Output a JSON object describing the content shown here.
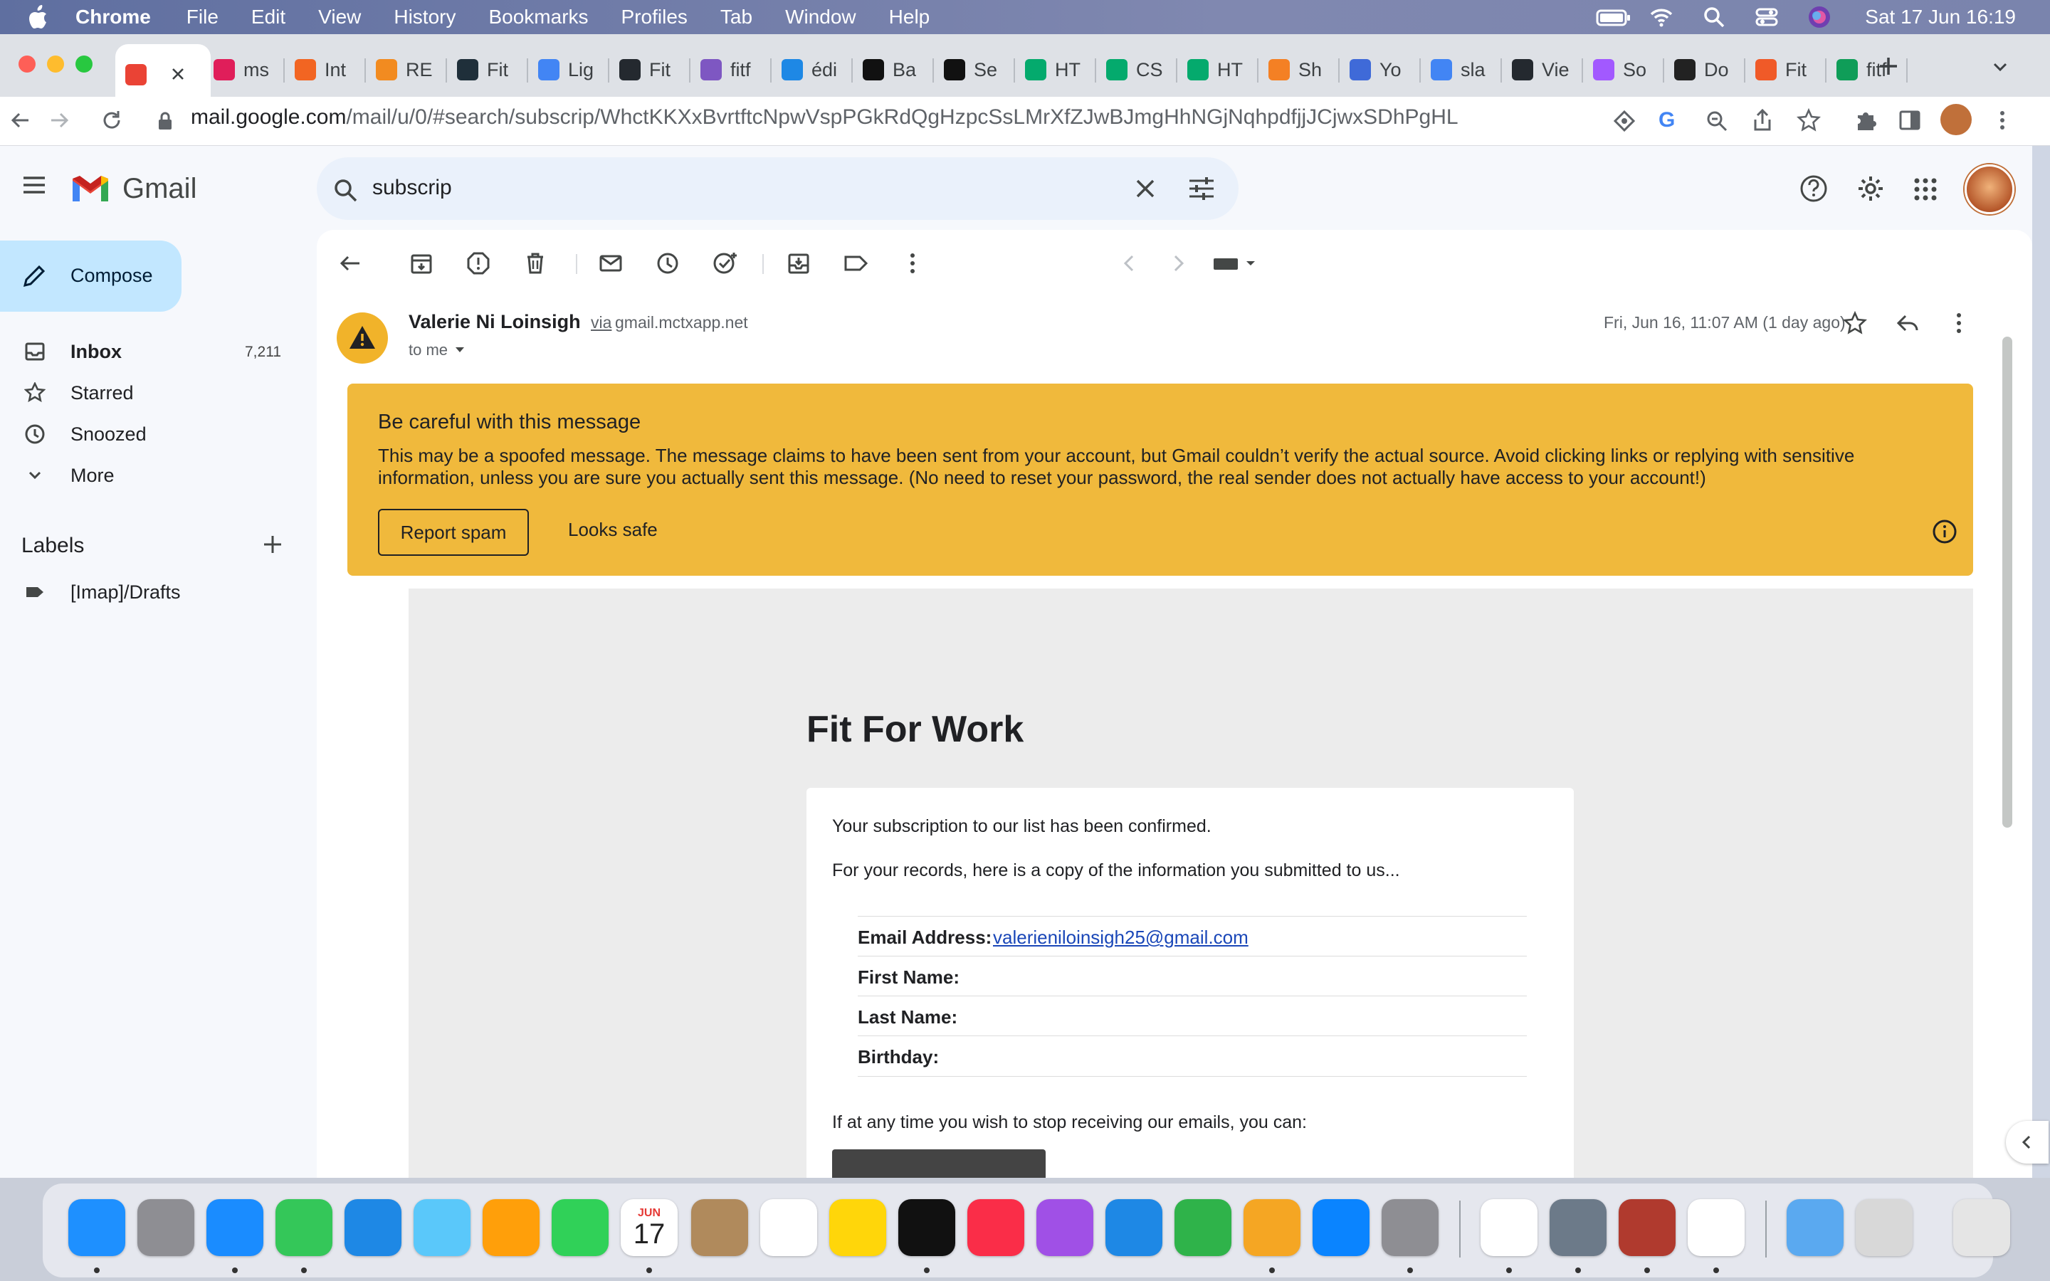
{
  "menubar": {
    "app": "Chrome",
    "items": [
      "File",
      "Edit",
      "View",
      "History",
      "Bookmarks",
      "Profiles",
      "Tab",
      "Window",
      "Help"
    ],
    "clock": "Sat 17 Jun  16:19"
  },
  "tabs": [
    {
      "title": "",
      "favicon": "gmail-icon",
      "color": "#ea4335",
      "active": true
    },
    {
      "title": "ms",
      "favicon": "slack-icon",
      "color": "#e01e5a"
    },
    {
      "title": "Int",
      "favicon": "ring-icon",
      "color": "#f26522"
    },
    {
      "title": "RE",
      "favicon": "g-orange-icon",
      "color": "#f28b20"
    },
    {
      "title": "Fit",
      "favicon": "terminal-icon",
      "color": "#1f2f3a"
    },
    {
      "title": "Lig",
      "favicon": "chrome-icon",
      "color": "#4285f4"
    },
    {
      "title": "Fit",
      "favicon": "github-icon",
      "color": "#24292f"
    },
    {
      "title": "fitf",
      "favicon": "h-icon",
      "color": "#7e57c2"
    },
    {
      "title": "édi",
      "favicon": "gif-icon",
      "color": "#1e88e5"
    },
    {
      "title": "Ba",
      "favicon": "codepen-icon",
      "color": "#111111"
    },
    {
      "title": "Se",
      "favicon": "codepen-icon",
      "color": "#111111"
    },
    {
      "title": "HT",
      "favicon": "w3-icon",
      "color": "#04aa6d"
    },
    {
      "title": "CS",
      "favicon": "w3-icon",
      "color": "#04aa6d"
    },
    {
      "title": "HT",
      "favicon": "w3-icon",
      "color": "#04aa6d"
    },
    {
      "title": "Sh",
      "favicon": "stackoverflow-icon",
      "color": "#f48024"
    },
    {
      "title": "Yo",
      "favicon": "flag-icon",
      "color": "#3f6ad8"
    },
    {
      "title": "sla",
      "favicon": "google-icon",
      "color": "#4285f4"
    },
    {
      "title": "Vie",
      "favicon": "github-icon",
      "color": "#24292f"
    },
    {
      "title": "So",
      "favicon": "figma-icon",
      "color": "#a259ff"
    },
    {
      "title": "Do",
      "favicon": "l-icon",
      "color": "#222222"
    },
    {
      "title": "Fit",
      "favicon": "hub-icon",
      "color": "#f05a28"
    },
    {
      "title": "fitf",
      "favicon": "sheet-icon",
      "color": "#0f9d58"
    }
  ],
  "addressbar": {
    "host": "mail.google.com",
    "path": "/mail/u/0/#search/subscrip/WhctKKXxBvrtftcNpwVspPGkRdQgHzpcSsLMrXfZJwBJmgHhNGjNqhpdfjjJCjwxSDhPgHL"
  },
  "gmail": {
    "logo_text": "Gmail",
    "search": {
      "query": "subscrip"
    },
    "compose": "Compose",
    "nav": [
      {
        "label": "Inbox",
        "count": "7,211",
        "icon": "inbox-icon",
        "bold": true
      },
      {
        "label": "Starred",
        "count": "",
        "icon": "star-icon"
      },
      {
        "label": "Snoozed",
        "count": "",
        "icon": "clock-icon"
      },
      {
        "label": "More",
        "count": "",
        "icon": "chevron-down-icon"
      }
    ],
    "labels_heading": "Labels",
    "labels": [
      {
        "label": "[Imap]/Drafts"
      }
    ]
  },
  "message": {
    "sender": "Valerie Ni Loinsigh",
    "via_word": "via",
    "via_domain": "gmail.mctxapp.net",
    "to": "to me",
    "date": "Fri, Jun 16, 11:07 AM (1 day ago)",
    "warning": {
      "title": "Be careful with this message",
      "body": "This may be a spoofed message. The message claims to have been sent from your account, but Gmail couldn’t verify the actual source. Avoid clicking links or replying with sensitive information, unless you are sure you actually sent this message. (No need to reset your password, the real sender does not actually have access to your account!)",
      "report_spam": "Report spam",
      "looks_safe": "Looks safe"
    },
    "body": {
      "title": "Fit For Work",
      "p1": "Your subscription to our list has been confirmed.",
      "p2": "For your records, here is a copy of the information you submitted to us...",
      "fields": [
        {
          "label": "Email Address:",
          "value": "valerieniloinsigh25@gmail.com"
        },
        {
          "label": "First Name:",
          "value": ""
        },
        {
          "label": "Last Name:",
          "value": ""
        },
        {
          "label": "Birthday:",
          "value": ""
        }
      ],
      "p3": "If at any time you wish to stop receiving our emails, you can:"
    }
  },
  "dock": {
    "apps": [
      {
        "name": "finder-icon",
        "color": "#1e90ff"
      },
      {
        "name": "launchpad-icon",
        "color": "#8e8e93"
      },
      {
        "name": "safari-icon",
        "color": "#1a8cff"
      },
      {
        "name": "messages-icon",
        "color": "#34c759"
      },
      {
        "name": "mail-icon",
        "color": "#1e88e5"
      },
      {
        "name": "maps-icon",
        "color": "#5ac8fa"
      },
      {
        "name": "photos-icon",
        "color": "#ff9f0a"
      },
      {
        "name": "facetime-icon",
        "color": "#30d158"
      },
      {
        "name": "calendar-icon",
        "color": "#ffffff"
      },
      {
        "name": "contacts-icon",
        "color": "#b08a5c"
      },
      {
        "name": "reminders-icon",
        "color": "#ffffff"
      },
      {
        "name": "notes-icon",
        "color": "#ffd60a"
      },
      {
        "name": "appletv-icon",
        "color": "#111111"
      },
      {
        "name": "music-icon",
        "color": "#fa2d48"
      },
      {
        "name": "podcasts-icon",
        "color": "#a050e6"
      },
      {
        "name": "keynote-icon",
        "color": "#1e88e5"
      },
      {
        "name": "numbers-icon",
        "color": "#2fb34a"
      },
      {
        "name": "pages-icon",
        "color": "#f5a623"
      },
      {
        "name": "appstore-icon",
        "color": "#0a84ff"
      },
      {
        "name": "system-settings-icon",
        "color": "#8e8e93"
      },
      {
        "name": "chrome-icon",
        "color": "#ffffff"
      },
      {
        "name": "preview-icon",
        "color": "#6c7a89"
      },
      {
        "name": "dictionary-icon",
        "color": "#b03a2e"
      },
      {
        "name": "chrome-canary-icon",
        "color": "#ffffff"
      },
      {
        "name": "downloads-folder-icon",
        "color": "#5aa9f0"
      },
      {
        "name": "recent-files-icon",
        "color": "#d8d8d8"
      },
      {
        "name": "trash-icon",
        "color": "#e5e5e5"
      }
    ],
    "calendar": {
      "month": "JUN",
      "day": "17"
    }
  }
}
